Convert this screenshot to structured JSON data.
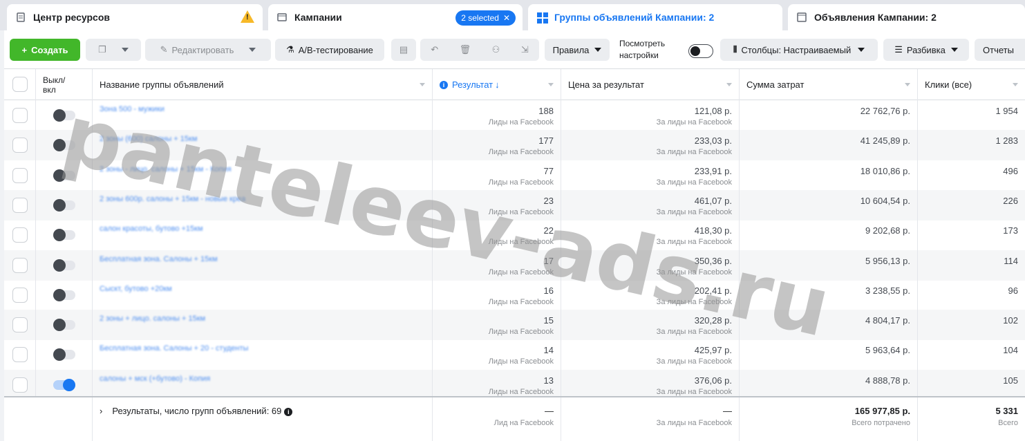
{
  "tabs": [
    {
      "label": "Центр ресурсов",
      "icon": "document-icon"
    },
    {
      "label": "Кампании",
      "icon": "folder-icon",
      "selected_pill": "2 selected"
    },
    {
      "label": "Группы объявлений Кампании: 2",
      "icon": "grid-icon"
    },
    {
      "label": "Объявления Кампании: 2",
      "icon": "window-icon"
    }
  ],
  "toolbar": {
    "create": "Создать",
    "edit": "Редактировать",
    "ab_test": "A/B-тестирование",
    "rules": "Правила",
    "view_settings": "Посмотреть настройки",
    "columns": "Столбцы: Настраиваемый",
    "breakdown": "Разбивка",
    "reports": "Отчеты"
  },
  "table": {
    "headers": {
      "onoff": "Выкл/ вкл",
      "name": "Название группы объявлений",
      "result": "Результат",
      "cost": "Цена за результат",
      "spent": "Сумма затрат",
      "clicks": "Клики (все)"
    },
    "rows": [
      {
        "name": "Зона 500 - мужики",
        "result": "188",
        "result_sub": "Лиды на Facebook",
        "cost": "121,08 р.",
        "cost_sub": "За лиды на Facebook",
        "spent": "22 762,76 р.",
        "clicks": "1 954",
        "on": false
      },
      {
        "name": "2 зоны (600) салоны + 15км",
        "result": "177",
        "result_sub": "Лиды на Facebook",
        "cost": "233,03 р.",
        "cost_sub": "За лиды на Facebook",
        "spent": "41 245,89 р.",
        "clicks": "1 283",
        "on": false
      },
      {
        "name": "2 зоны - лицо. салоны + 15км - Копия",
        "result": "77",
        "result_sub": "Лиды на Facebook",
        "cost": "233,91 р.",
        "cost_sub": "За лиды на Facebook",
        "spent": "18 010,86 р.",
        "clicks": "496",
        "on": false
      },
      {
        "name": "2 зоны 600р. салоны + 15км - новые креа",
        "result": "23",
        "result_sub": "Лиды на Facebook",
        "cost": "461,07 р.",
        "cost_sub": "За лиды на Facebook",
        "spent": "10 604,54 р.",
        "clicks": "226",
        "on": false
      },
      {
        "name": "салон красоты, бутово +15км",
        "result": "22",
        "result_sub": "Лиды на Facebook",
        "cost": "418,30 р.",
        "cost_sub": "За лиды на Facebook",
        "spent": "9 202,68 р.",
        "clicks": "173",
        "on": false
      },
      {
        "name": "Бесплатная зона. Салоны + 15км",
        "result": "17",
        "result_sub": "Лиды на Facebook",
        "cost": "350,36 р.",
        "cost_sub": "За лиды на Facebook",
        "spent": "5 956,13 р.",
        "clicks": "114",
        "on": false
      },
      {
        "name": "Сыскт, бутово +20км",
        "result": "16",
        "result_sub": "Лиды на Facebook",
        "cost": "202,41 р.",
        "cost_sub": "За лиды на Facebook",
        "spent": "3 238,55 р.",
        "clicks": "96",
        "on": false
      },
      {
        "name": "2 зоны + лицо. салоны + 15км",
        "result": "15",
        "result_sub": "Лиды на Facebook",
        "cost": "320,28 р.",
        "cost_sub": "За лиды на Facebook",
        "spent": "4 804,17 р.",
        "clicks": "102",
        "on": false
      },
      {
        "name": "Бесплатная зона. Салоны + 20 - студенты",
        "result": "14",
        "result_sub": "Лиды на Facebook",
        "cost": "425,97 р.",
        "cost_sub": "За лиды на Facebook",
        "spent": "5 963,64 р.",
        "clicks": "104",
        "on": false
      },
      {
        "name": "салоны + мск (+бутово) - Копия",
        "result": "13",
        "result_sub": "Лиды на Facebook",
        "cost": "376,06 р.",
        "cost_sub": "За лиды на Facebook",
        "spent": "4 888,78 р.",
        "clicks": "105",
        "on": true
      }
    ],
    "footer": {
      "label": "Результаты, число групп объявлений: 69",
      "result": "—",
      "result_sub": "Лид на Facebook",
      "cost": "—",
      "cost_sub": "За лиды на Facebook",
      "spent": "165 977,85 р.",
      "spent_sub": "Всего потрачено",
      "clicks": "5 331",
      "clicks_sub": "Всего"
    }
  },
  "watermark": "panteleev-ads.ru"
}
